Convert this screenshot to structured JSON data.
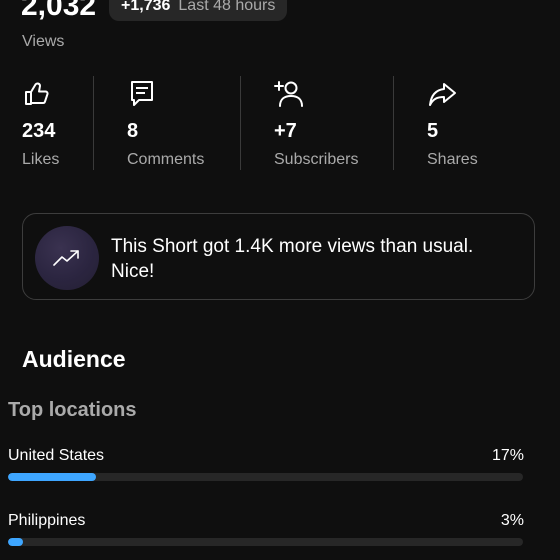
{
  "summary": {
    "views_total": "2,032",
    "views_delta": "+1,736",
    "views_period": "Last 48 hours",
    "views_label": "Views"
  },
  "stats": [
    {
      "value": "234",
      "label": "Likes",
      "icon": "thumbs-up-icon"
    },
    {
      "value": "8",
      "label": "Comments",
      "icon": "comment-icon"
    },
    {
      "value": "+7",
      "label": "Subscribers",
      "icon": "add-person-icon"
    },
    {
      "value": "5",
      "label": "Shares",
      "icon": "share-icon"
    }
  ],
  "insight": {
    "icon": "trending-up-icon",
    "text": "This Short got 1.4K more views than usual. Nice!"
  },
  "audience": {
    "title": "Audience",
    "top_locations_title": "Top locations",
    "locations": [
      {
        "name": "United States",
        "percent_label": "17%",
        "percent": 17
      },
      {
        "name": "Philippines",
        "percent_label": "3%",
        "percent": 3
      }
    ]
  },
  "colors": {
    "background": "#0f0f0f",
    "accent_bar": "#3ea6ff",
    "track": "#272727",
    "secondary_text": "#aaaaaa"
  }
}
